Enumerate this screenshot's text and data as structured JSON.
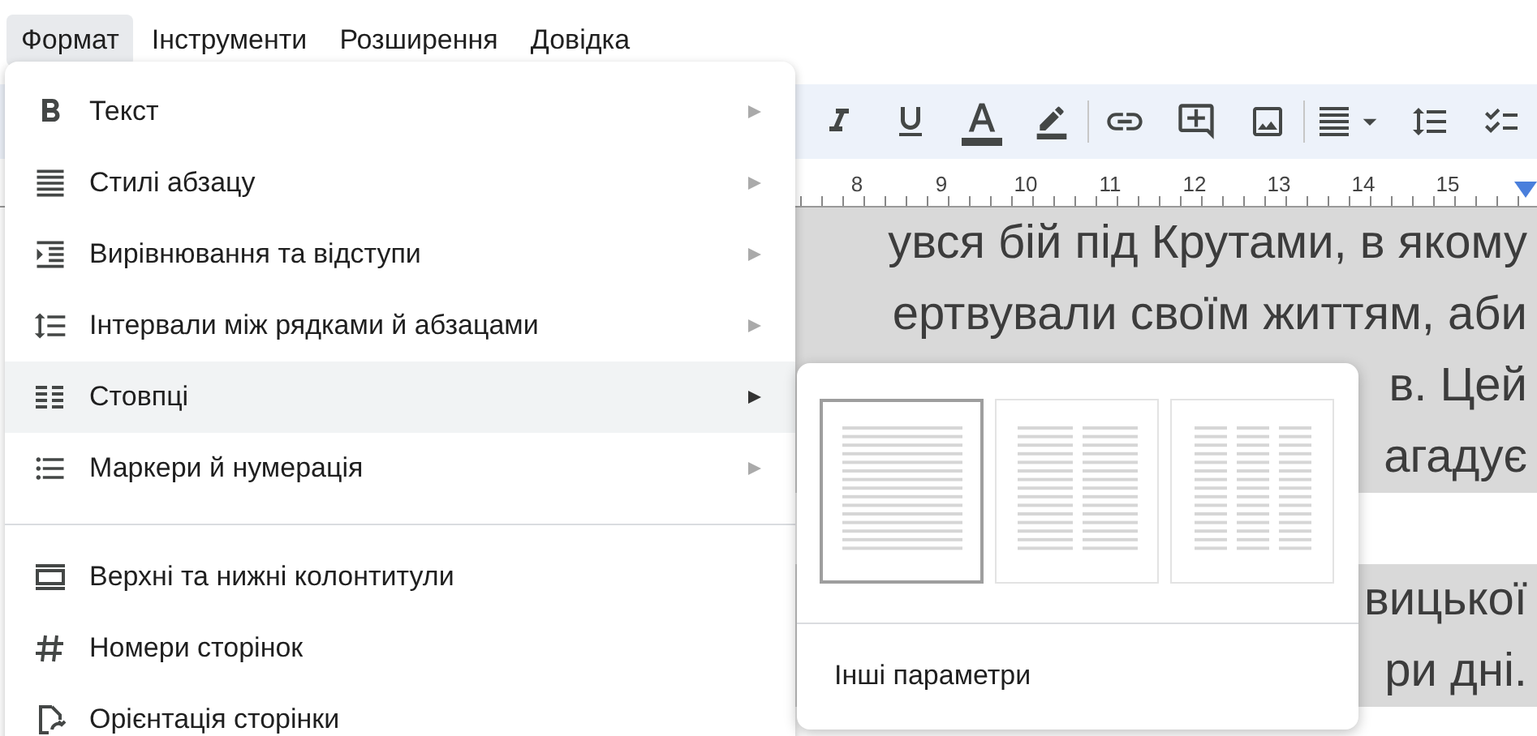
{
  "menu_bar": [
    {
      "label": "Формат",
      "selected": true
    },
    {
      "label": "Інструменти",
      "selected": false
    },
    {
      "label": "Розширення",
      "selected": false
    },
    {
      "label": "Довідка",
      "selected": false
    }
  ],
  "ruler": [
    "8",
    "9",
    "10",
    "11",
    "12",
    "13",
    "14",
    "15"
  ],
  "document": {
    "paragraphs": [
      {
        "lines": [
          "увся бій під Крутами, в якому",
          "ертвували своїм життям, аби",
          "в. Цей",
          "агадує"
        ]
      },
      {
        "lines": [
          "вицької",
          "ри дні."
        ]
      }
    ]
  },
  "format_menu": {
    "groups": [
      {
        "items": [
          {
            "label": "Текст",
            "submenu": true,
            "selected": false
          },
          {
            "label": "Стилі абзацу",
            "submenu": true,
            "selected": false
          },
          {
            "label": "Вирівнювання та відступи",
            "submenu": true,
            "selected": false
          },
          {
            "label": "Інтервали між рядками й абзацами",
            "submenu": true,
            "selected": false
          },
          {
            "label": "Стовпці",
            "submenu": true,
            "selected": true
          },
          {
            "label": "Маркери й нумерація",
            "submenu": true,
            "selected": false
          }
        ]
      },
      {
        "items": [
          {
            "label": "Верхні та нижні колонтитули",
            "submenu": false,
            "selected": false
          },
          {
            "label": "Номери сторінок",
            "submenu": false,
            "selected": false
          },
          {
            "label": "Орієнтація сторінки",
            "submenu": false,
            "selected": false
          }
        ]
      }
    ]
  },
  "columns_submenu": {
    "options": [
      {
        "selected": true
      },
      {
        "selected": false
      },
      {
        "selected": false
      }
    ],
    "more_options": "Інші параметри"
  }
}
